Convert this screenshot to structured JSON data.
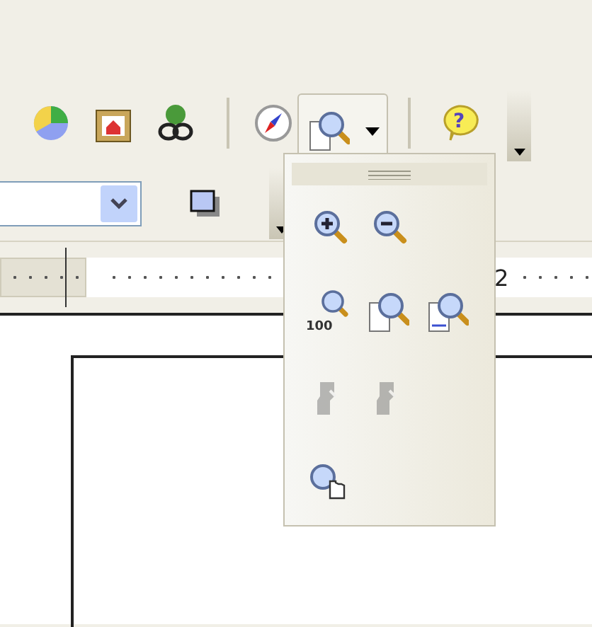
{
  "toolbar_top": {
    "buttons": [
      {
        "kind": "chart"
      },
      {
        "kind": "picture"
      },
      {
        "kind": "hyperlink"
      },
      {
        "kind": "separator"
      },
      {
        "kind": "navigator"
      },
      {
        "kind": "zoom-menu",
        "expanded": true
      },
      {
        "kind": "separator"
      },
      {
        "kind": "help",
        "label": "?"
      },
      {
        "kind": "overflow"
      }
    ]
  },
  "toolbar_bottom": {
    "buttons": [
      {
        "kind": "combo"
      },
      {
        "kind": "shadow"
      },
      {
        "kind": "overflow"
      }
    ]
  },
  "ruler": {
    "label": "2"
  },
  "zoom_popup": {
    "rows": [
      [
        {
          "kind": "zoom-in",
          "disabled": false
        },
        {
          "kind": "zoom-out",
          "disabled": false
        }
      ],
      [
        {
          "kind": "zoom-100",
          "label": "100",
          "disabled": false
        },
        {
          "kind": "whole-page",
          "disabled": false
        },
        {
          "kind": "page-width",
          "disabled": false
        }
      ],
      [
        {
          "kind": "person",
          "disabled": true
        },
        {
          "kind": "person",
          "disabled": true
        }
      ],
      [
        {
          "kind": "pan",
          "disabled": false
        }
      ]
    ]
  }
}
